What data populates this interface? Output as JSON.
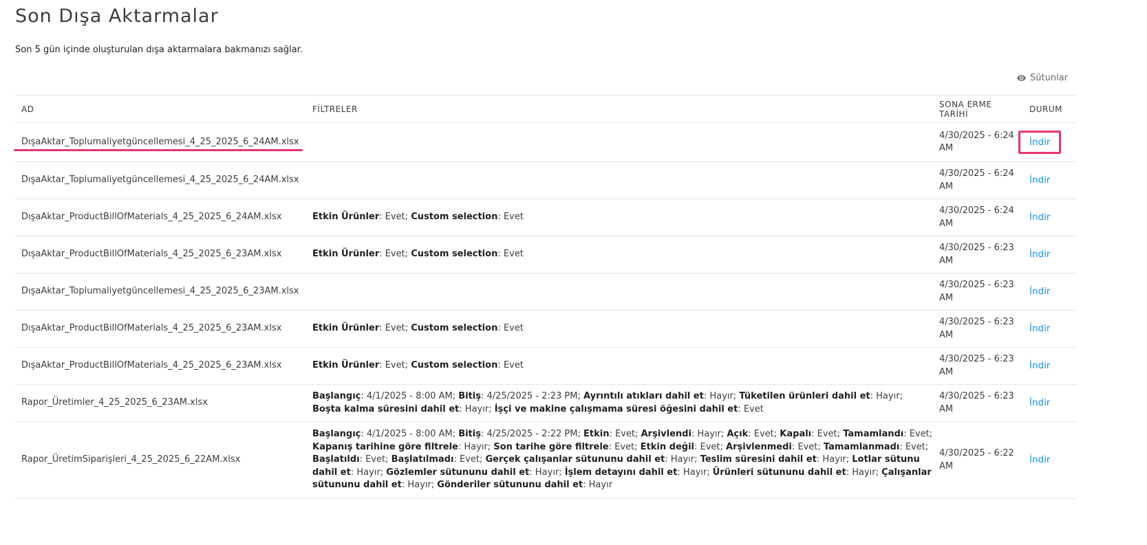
{
  "page": {
    "title": "Son Dışa Aktarmalar",
    "subtitle": "Son 5 gün içinde oluşturulan dışa aktarmalara bakmanızı sağlar."
  },
  "toolbar": {
    "columns_label": "Sütunlar",
    "columns_icon": "eye-icon"
  },
  "table": {
    "headers": {
      "name": "AD",
      "filters": "FİLTRELER",
      "expires": "SONA ERME TARİHİ",
      "status": "DURUM"
    },
    "rows": [
      {
        "name": "DışaAktar_Toplumaliyetgüncellemesi_4_25_2025_6_24AM.xlsx",
        "filters": [],
        "expires": "4/30/2025 - 6:24 AM",
        "action": "İndir",
        "highlighted": true
      },
      {
        "name": "DışaAktar_Toplumaliyetgüncellemesi_4_25_2025_6_24AM.xlsx",
        "filters": [],
        "expires": "4/30/2025 - 6:24 AM",
        "action": "İndir"
      },
      {
        "name": "DışaAktar_ProductBillOfMaterials_4_25_2025_6_24AM.xlsx",
        "filters": [
          {
            "k": "Etkin Ürünler",
            "v": "Evet"
          },
          {
            "k": "Custom selection",
            "v": "Evet"
          }
        ],
        "expires": "4/30/2025 - 6:24 AM",
        "action": "İndir"
      },
      {
        "name": "DışaAktar_ProductBillOfMaterials_4_25_2025_6_23AM.xlsx",
        "filters": [
          {
            "k": "Etkin Ürünler",
            "v": "Evet"
          },
          {
            "k": "Custom selection",
            "v": "Evet"
          }
        ],
        "expires": "4/30/2025 - 6:23 AM",
        "action": "İndir"
      },
      {
        "name": "DışaAktar_Toplumaliyetgüncellemesi_4_25_2025_6_23AM.xlsx",
        "filters": [],
        "expires": "4/30/2025 - 6:23 AM",
        "action": "İndir"
      },
      {
        "name": "DışaAktar_ProductBillOfMaterials_4_25_2025_6_23AM.xlsx",
        "filters": [
          {
            "k": "Etkin Ürünler",
            "v": "Evet"
          },
          {
            "k": "Custom selection",
            "v": "Evet"
          }
        ],
        "expires": "4/30/2025 - 6:23 AM",
        "action": "İndir"
      },
      {
        "name": "DışaAktar_ProductBillOfMaterials_4_25_2025_6_23AM.xlsx",
        "filters": [
          {
            "k": "Etkin Ürünler",
            "v": "Evet"
          },
          {
            "k": "Custom selection",
            "v": "Evet"
          }
        ],
        "expires": "4/30/2025 - 6:23 AM",
        "action": "İndir"
      },
      {
        "name": "Rapor_Üretimler_4_25_2025_6_23AM.xlsx",
        "filters": [
          {
            "k": "Başlangıç",
            "v": "4/1/2025 - 8:00 AM"
          },
          {
            "k": "Bitiş",
            "v": "4/25/2025 - 2:23 PM"
          },
          {
            "k": "Ayrıntılı atıkları dahil et",
            "v": "Hayır"
          },
          {
            "k": "Tüketilen ürünleri dahil et",
            "v": "Hayır"
          },
          {
            "k": "Boşta kalma süresini dahil et",
            "v": "Hayır"
          },
          {
            "k": "İşçi ve makine çalışmama süresi öğesini dahil et",
            "v": "Evet"
          }
        ],
        "expires": "4/30/2025 - 6:23 AM",
        "action": "İndir"
      },
      {
        "name": "Rapor_ÜretimSiparişleri_4_25_2025_6_22AM.xlsx",
        "filters": [
          {
            "k": "Başlangıç",
            "v": "4/1/2025 - 8:00 AM"
          },
          {
            "k": "Bitiş",
            "v": "4/25/2025 - 2:22 PM"
          },
          {
            "k": "Etkin",
            "v": "Evet"
          },
          {
            "k": "Arşivlendi",
            "v": "Hayır"
          },
          {
            "k": "Açık",
            "v": "Evet"
          },
          {
            "k": "Kapalı",
            "v": "Evet"
          },
          {
            "k": "Tamamlandı",
            "v": "Evet"
          },
          {
            "k": "Kapanış tarihine göre filtrele",
            "v": "Hayır"
          },
          {
            "k": "Son tarihe göre filtrele",
            "v": "Evet"
          },
          {
            "k": "Etkin değil",
            "v": "Evet"
          },
          {
            "k": "Arşivlenmedi",
            "v": "Evet"
          },
          {
            "k": "Tamamlanmadı",
            "v": "Evet"
          },
          {
            "k": "Başlatıldı",
            "v": "Evet"
          },
          {
            "k": "Başlatılmadı",
            "v": "Evet"
          },
          {
            "k": "Gerçek çalışanlar sütununu dahil et",
            "v": "Hayır"
          },
          {
            "k": "Teslim süresini dahil et",
            "v": "Hayır"
          },
          {
            "k": "Lotlar sütunu dahil et",
            "v": "Hayır"
          },
          {
            "k": "Gözlemler sütununu dahil et",
            "v": "Hayır"
          },
          {
            "k": "İşlem detayını dahil et",
            "v": "Hayır"
          },
          {
            "k": "Ürünleri sütununu dahil et",
            "v": "Hayır"
          },
          {
            "k": "Çalışanlar sütununu dahil et",
            "v": "Hayır"
          },
          {
            "k": "Gönderiler sütununu dahil et",
            "v": "Hayır"
          }
        ],
        "expires": "4/30/2025 - 6:22 AM",
        "action": "İndir"
      }
    ]
  },
  "colors": {
    "link": "#1a90d4",
    "highlight": "#e8336f",
    "border": "#e6e6e6"
  }
}
